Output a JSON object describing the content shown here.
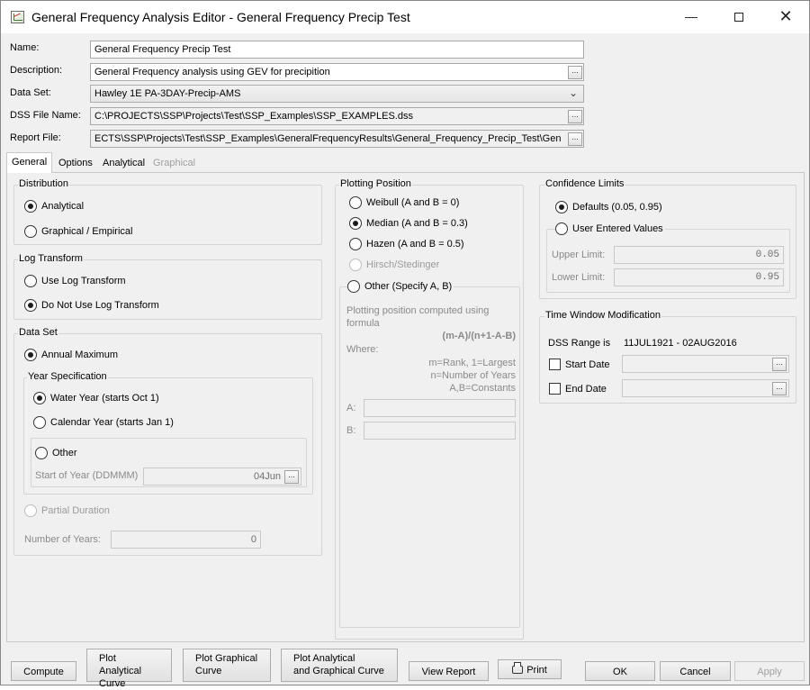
{
  "window": {
    "title": "General Frequency Analysis Editor - General Frequency Precip Test",
    "icon": "frequency-chart-icon",
    "minimize": "—",
    "close": "✕"
  },
  "header": {
    "name_label": "Name:",
    "name_value": "General Frequency Precip Test",
    "description_label": "Description:",
    "description_value": "General Frequency analysis using GEV for precipition",
    "dataset_label": "Data Set:",
    "dataset_value": "Hawley 1E PA-3DAY-Precip-AMS",
    "dss_label": "DSS File Name:",
    "dss_value": "C:\\PROJECTS\\SSP\\Projects\\Test\\SSP_Examples\\SSP_EXAMPLES.dss",
    "report_label": "Report File:",
    "report_value": "ECTS\\SSP\\Projects\\Test\\SSP_Examples\\GeneralFrequencyResults\\General_Frequency_Precip_Test\\Gen",
    "ellipsis": "..."
  },
  "tabs": [
    {
      "label": "General"
    },
    {
      "label": "Options"
    },
    {
      "label": "Analytical"
    },
    {
      "label": "Graphical"
    }
  ],
  "distribution": {
    "title": "Distribution",
    "analytical": "Analytical",
    "graphical": "Graphical / Empirical",
    "selected": "analytical"
  },
  "log_transform": {
    "title": "Log Transform",
    "use": "Use Log Transform",
    "do_not_use": "Do Not Use Log Transform",
    "selected": "do_not_use"
  },
  "data_set": {
    "title": "Data Set",
    "annual_max": "Annual Maximum",
    "year_spec_title": "Year Specification",
    "water_year": "Water Year (starts Oct 1)",
    "calendar_year": "Calendar Year (starts Jan 1)",
    "other": "Other",
    "start_of_year_label": "Start of Year (DDMMM)",
    "start_of_year_value": "04Jun",
    "partial_duration": "Partial Duration",
    "num_years_label": "Number of Years:",
    "num_years_value": "0"
  },
  "plotting_position": {
    "title": "Plotting Position",
    "weibull": "Weibull (A and B = 0)",
    "median": "Median (A and B = 0.3)",
    "hazen": "Hazen (A and B = 0.5)",
    "hirsch": "Hirsch/Stedinger",
    "other": "Other (Specify A, B)",
    "computed_text": "Plotting position computed using formula",
    "formula": "(m-A)/(n+1-A-B)",
    "where": "Where:",
    "m_def": "m=Rank, 1=Largest",
    "n_def": "n=Number of Years",
    "ab_def": "A,B=Constants",
    "a_label": "A:",
    "b_label": "B:",
    "selected": "median"
  },
  "confidence_limits": {
    "title": "Confidence Limits",
    "defaults": "Defaults (0.05, 0.95)",
    "user_entered": "User Entered Values",
    "upper_label": "Upper Limit:",
    "upper_value": "0.05",
    "lower_label": "Lower Limit:",
    "lower_value": "0.95",
    "selected": "defaults"
  },
  "time_window": {
    "title": "Time Window Modification",
    "dss_range_label": "DSS Range is",
    "dss_range_value": "11JUL1921 - 02AUG2016",
    "start_date": "Start Date",
    "end_date": "End Date"
  },
  "buttons": {
    "compute": "Compute",
    "plot_analytical_1": "Plot Analytical",
    "plot_analytical_2": "Curve",
    "plot_graphical_1": "Plot Graphical",
    "plot_graphical_2": "Curve",
    "plot_both_1": "Plot Analytical",
    "plot_both_2": "and Graphical Curve",
    "view_report": "View Report",
    "print": "Print",
    "ok": "OK",
    "cancel": "Cancel",
    "apply": "Apply"
  }
}
